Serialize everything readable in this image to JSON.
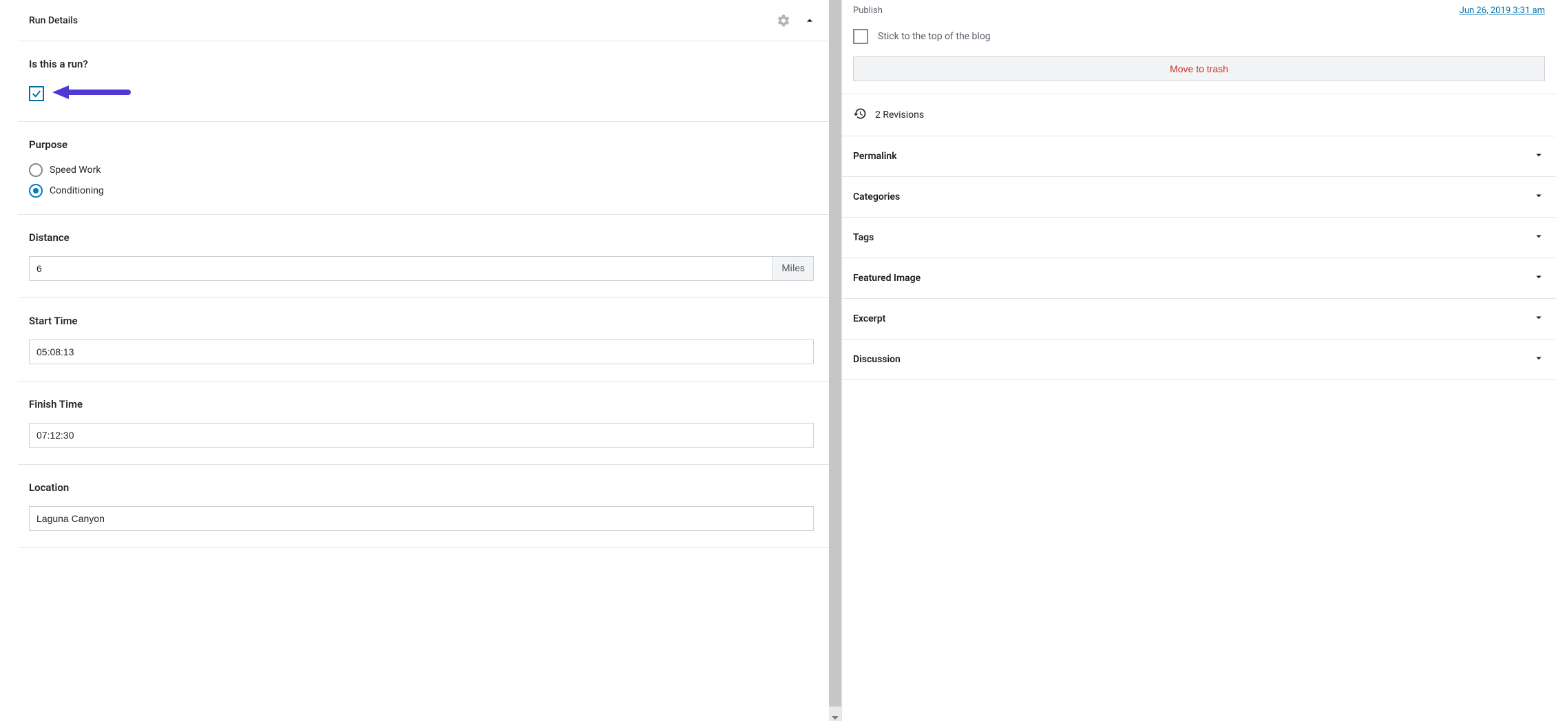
{
  "panel": {
    "title": "Run Details"
  },
  "fields": {
    "is_run": {
      "label": "Is this a run?",
      "checked": true
    },
    "purpose": {
      "label": "Purpose",
      "options": [
        {
          "label": "Speed Work",
          "selected": false
        },
        {
          "label": "Conditioning",
          "selected": true
        }
      ]
    },
    "distance": {
      "label": "Distance",
      "value": "6",
      "unit": "Miles"
    },
    "start_time": {
      "label": "Start Time",
      "value": "05:08:13"
    },
    "finish_time": {
      "label": "Finish Time",
      "value": "07:12:30"
    },
    "location": {
      "label": "Location",
      "value": "Laguna Canyon"
    }
  },
  "sidebar": {
    "publish": {
      "label": "Publish",
      "value": "Jun 26, 2019 3:31 am"
    },
    "stick_label": "Stick to the top of the blog",
    "trash_label": "Move to trash",
    "revisions_label": "2 Revisions",
    "panels": [
      {
        "label": "Permalink"
      },
      {
        "label": "Categories"
      },
      {
        "label": "Tags"
      },
      {
        "label": "Featured Image"
      },
      {
        "label": "Excerpt"
      },
      {
        "label": "Discussion"
      }
    ]
  }
}
